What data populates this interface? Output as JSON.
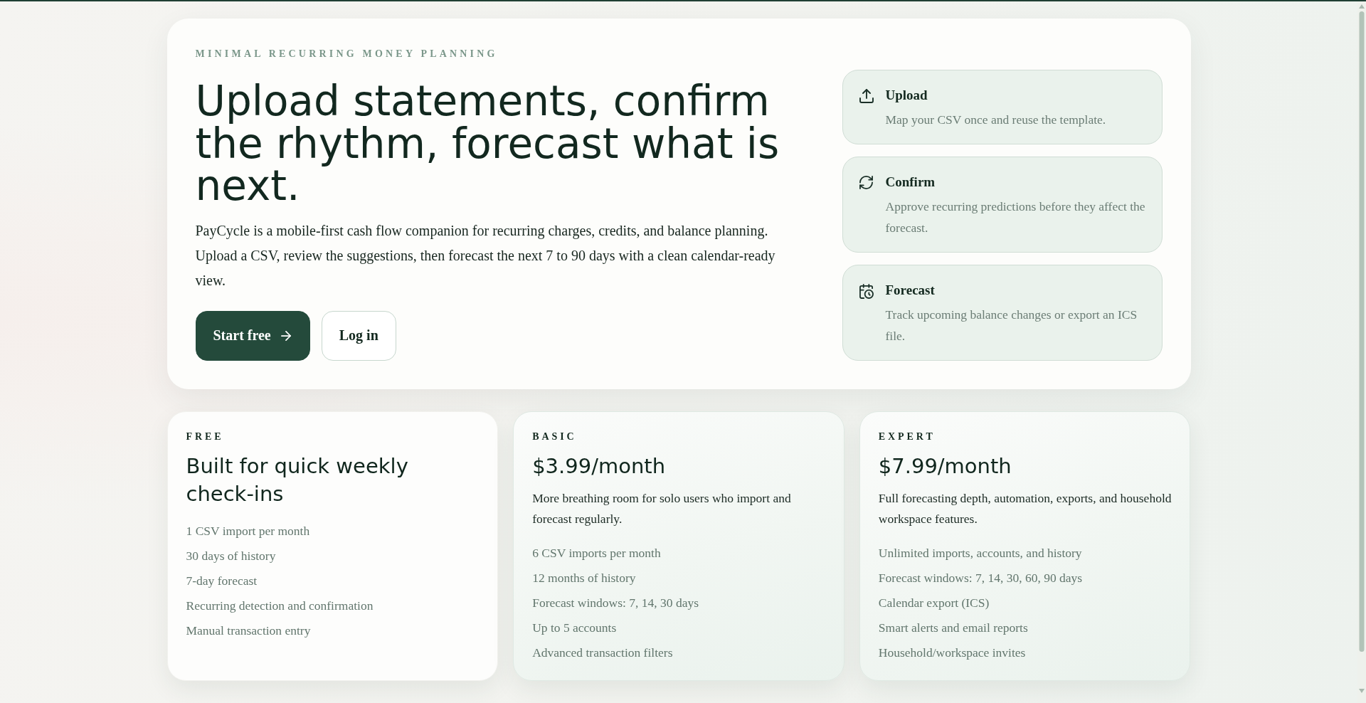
{
  "hero": {
    "eyebrow": "MINIMAL RECURRING MONEY PLANNING",
    "headline": "Upload statements, confirm the rhythm, forecast what is next.",
    "intro": "PayCycle is a mobile-first cash flow companion for recurring charges, credits, and balance planning. Upload a CSV, review the suggestions, then forecast the next 7 to 90 days with a clean calendar-ready view.",
    "actions": [
      {
        "label": "Start free",
        "kind": "primary"
      },
      {
        "label": "Log in",
        "kind": "secondary"
      }
    ],
    "steps": [
      {
        "title": "Upload",
        "description": "Map your CSV once and reuse the template."
      },
      {
        "title": "Confirm",
        "description": "Approve recurring predictions before they affect the forecast."
      },
      {
        "title": "Forecast",
        "description": "Track upcoming balance changes or export an ICS file."
      }
    ]
  },
  "plans": [
    {
      "kind": "free",
      "tier": "FREE",
      "title": "Built for quick weekly check-ins",
      "features": [
        "1 CSV import per month",
        "30 days of history",
        "7-day forecast",
        "Recurring detection and confirmation",
        "Manual transaction entry"
      ]
    },
    {
      "kind": "paid",
      "tier": "BASIC",
      "price": "$3.99/month",
      "description": "More breathing room for solo users who import and forecast regularly.",
      "features": [
        "6 CSV imports per month",
        "12 months of history",
        "Forecast windows: 7, 14, 30 days",
        "Up to 5 accounts",
        "Advanced transaction filters"
      ]
    },
    {
      "kind": "paid",
      "tier": "EXPERT",
      "price": "$7.99/month",
      "description": "Full forecasting depth, automation, exports, and household workspace features.",
      "features": [
        "Unlimited imports, accounts, and history",
        "Forecast windows: 7, 14, 30, 60, 90 days",
        "Calendar export (ICS)",
        "Smart alerts and email reports",
        "Household/workspace invites"
      ]
    }
  ]
}
